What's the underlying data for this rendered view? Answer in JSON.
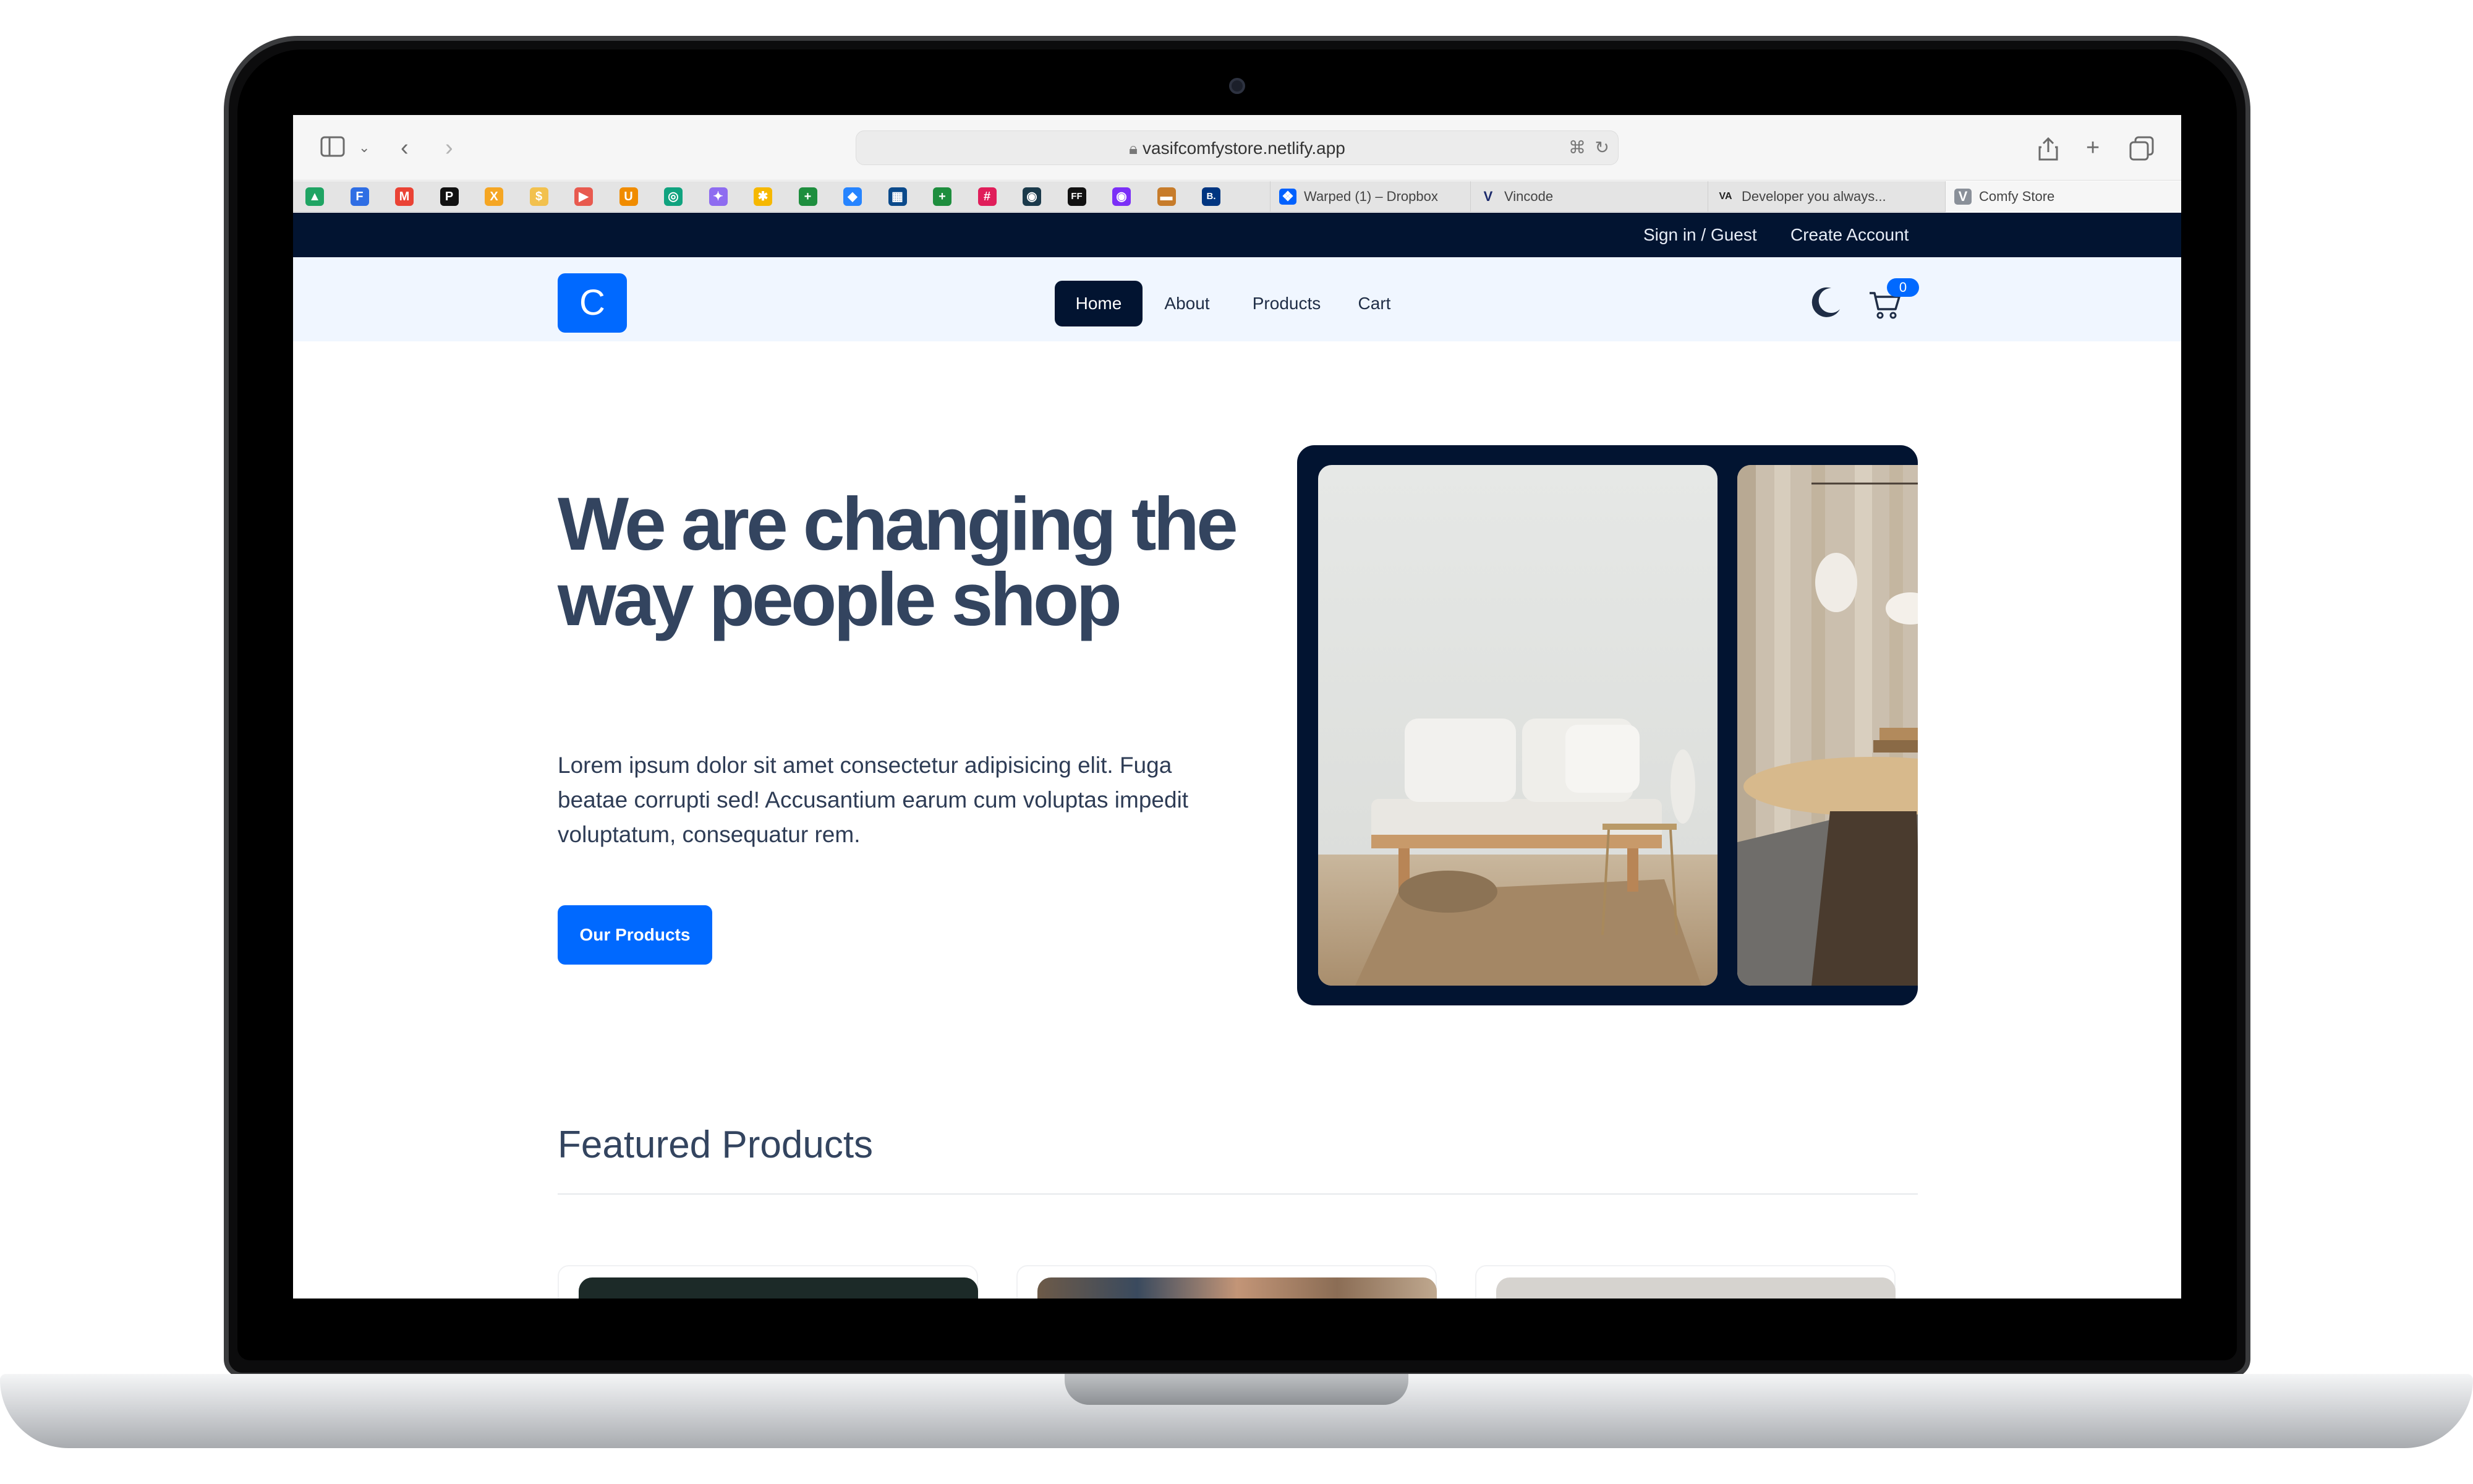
{
  "browser": {
    "url": "vasifcomfystore.netlify.app",
    "bookmarks": [
      {
        "icon": "google-drive-icon",
        "glyph": "▲",
        "color": "#1fa463"
      },
      {
        "icon": "forms-icon",
        "glyph": "F",
        "color": "#2f6ee4"
      },
      {
        "icon": "gmail-icon",
        "glyph": "M",
        "color": "#ea4335"
      },
      {
        "icon": "pinterest-icon",
        "glyph": "P",
        "color": "#111111"
      },
      {
        "icon": "x-icon",
        "glyph": "X",
        "color": "#f5a623"
      },
      {
        "icon": "coin-icon",
        "glyph": "$",
        "color": "#f2c14e"
      },
      {
        "icon": "red-app-icon",
        "glyph": "▶",
        "color": "#e85a4f"
      },
      {
        "icon": "u-app-icon",
        "glyph": "U",
        "color": "#f08c00"
      },
      {
        "icon": "chatgpt-icon",
        "glyph": "◎",
        "color": "#10a37f"
      },
      {
        "icon": "gemini-icon",
        "glyph": "✦",
        "color": "#8e6cf0"
      },
      {
        "icon": "yellow-circle-icon",
        "glyph": "✱",
        "color": "#f6b800"
      },
      {
        "icon": "sheets-icon",
        "glyph": "+",
        "color": "#1e8e3e"
      },
      {
        "icon": "jira-icon",
        "glyph": "◆",
        "color": "#2684ff"
      },
      {
        "icon": "library-icon",
        "glyph": "▦",
        "color": "#0b4a8b"
      },
      {
        "icon": "sheets-icon-2",
        "glyph": "+",
        "color": "#1e8e3e"
      },
      {
        "icon": "slack-icon",
        "glyph": "#",
        "color": "#e01e5a"
      },
      {
        "icon": "dark-app-icon",
        "glyph": "◉",
        "color": "#1b3a4b"
      },
      {
        "icon": "ff-icon",
        "glyph": "FF",
        "color": "#111111"
      },
      {
        "icon": "purple-circle-icon",
        "glyph": "◉",
        "color": "#7b2ff7"
      },
      {
        "icon": "wallet-icon",
        "glyph": "▬",
        "color": "#c77c2b"
      },
      {
        "icon": "booking-icon",
        "glyph": "B.",
        "color": "#003580"
      }
    ],
    "tabs": [
      {
        "label": "Warped (1) – Dropbox",
        "icon": "dropbox-icon",
        "glyph": "❖",
        "color": "#0061fe"
      },
      {
        "label": "Vincode",
        "icon": "vincode-icon",
        "glyph": "V",
        "color": "#1b2a6b"
      },
      {
        "label": "Developer you always...",
        "icon": "va-icon",
        "glyph": "VA",
        "color": "#222222"
      },
      {
        "label": "Comfy Store",
        "icon": "comfy-store-icon",
        "glyph": "V",
        "color": "#8a9099"
      }
    ]
  },
  "topbar": {
    "signin": "Sign in / Guest",
    "create": "Create Account"
  },
  "navbar": {
    "logo": "C",
    "links": [
      "Home",
      "About",
      "Products",
      "Cart"
    ],
    "active": "Home",
    "cart_count": "0"
  },
  "hero": {
    "title": "We are changing the way people shop",
    "text": "Lorem ipsum dolor sit amet consectetur adipisicing elit. Fuga beatae corrupti sed! Accusantium earum cum voluptas impedit voluptatum, consequatur rem.",
    "button": "Our Products"
  },
  "featured": {
    "title": "Featured Products"
  },
  "colors": {
    "brand": "#0069ff",
    "dark": "#021431",
    "nav_bg": "#f0f6ff",
    "heading": "#33445f"
  }
}
